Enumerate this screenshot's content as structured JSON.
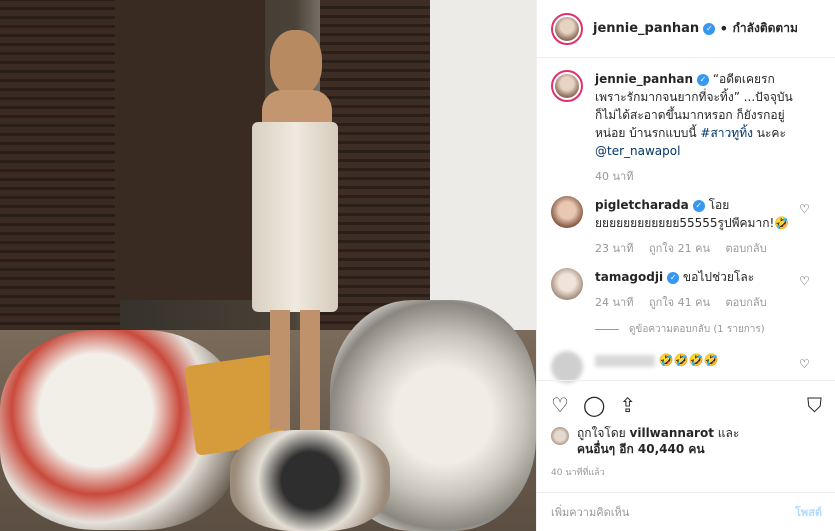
{
  "post": {
    "author": "jennie_panhan",
    "follow_state": "กำลังติดตาม",
    "separator": "•"
  },
  "caption": {
    "author": "jennie_panhan",
    "text": "“อดีตเคยรก เพราะรักมากจนยากที่จะทิ้ง” ...ปัจจุบันก็ไม่ได้สะอาดขึ้นมากหรอก ก็ยังรกอยู่หน่อย บ้านรกแบบนี้ ",
    "hashtag": "#สาวทูทิ้ง",
    "suffix": " นะคะ ",
    "mention": "@ter_nawapol",
    "time": "40 นาที"
  },
  "comments": [
    {
      "author": "pigletcharada",
      "text": "โอยยยยยยยยยยยยย55555รูปพีคมาก!🤣",
      "time": "23 นาที",
      "likes": "ถูกใจ 21 คน",
      "reply": "ตอบกลับ"
    },
    {
      "author": "tamagodji",
      "text": "ขอไปช่วยโละ",
      "time": "24 นาที",
      "likes": "ถูกใจ 41 คน",
      "reply": "ตอบกลับ",
      "view_replies": "ดูข้อความตอบกลับ (1 รายการ)"
    },
    {
      "author": "",
      "text": "🤣🤣🤣🤣"
    }
  ],
  "likes": {
    "liked_by_prefix": "ถูกใจโดย ",
    "liked_by_user": "villwannarot",
    "and": " และ",
    "others": "คนอื่นๆ อีก 40,440 คน"
  },
  "timestamp": "40 นาทีที่แล้ว",
  "add_comment": {
    "placeholder": "เพิ่มความคิดเห็น",
    "post_label": "โพสต์"
  },
  "icons": {
    "like": "heart-icon",
    "comment": "comment-icon",
    "share": "share-icon",
    "save": "bookmark-icon"
  },
  "colors": {
    "verified": "#3897f0",
    "story_ring": "#e1306c",
    "link": "#003569"
  }
}
